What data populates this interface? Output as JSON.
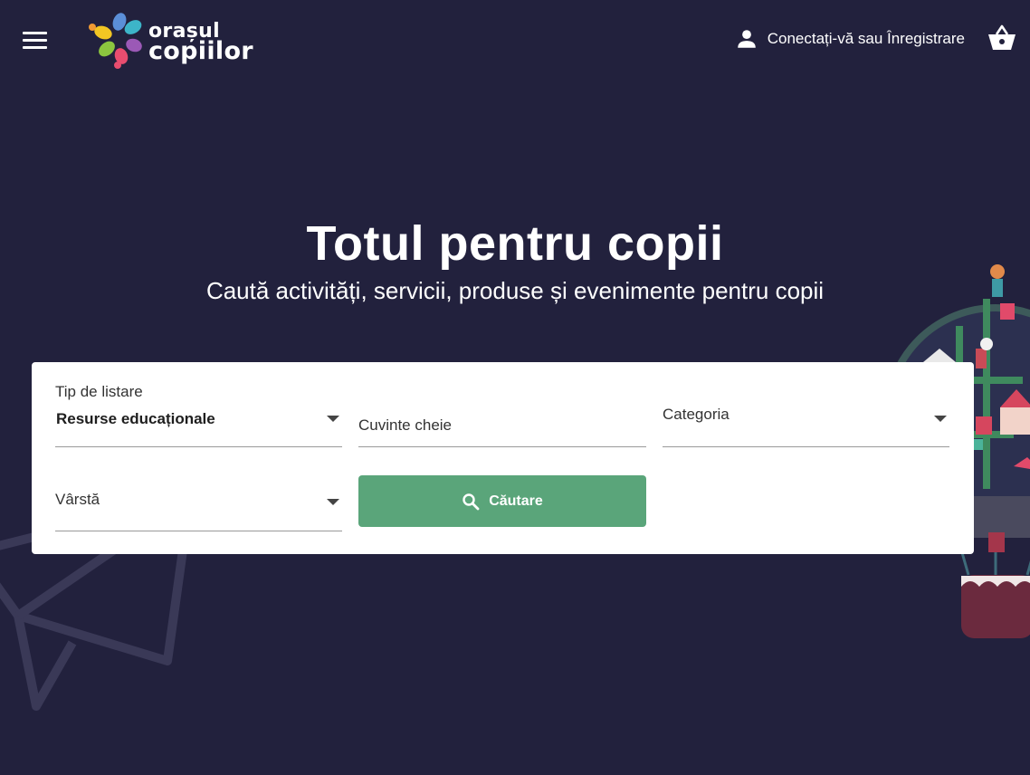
{
  "header": {
    "logo_line1": "orașul",
    "logo_line2": "copiilor",
    "login_label": "Conectați-vă sau Înregistrare"
  },
  "hero": {
    "title": "Totul pentru copii",
    "subtitle": "Caută activități, servicii, produse și evenimente pentru copii"
  },
  "search": {
    "listing_type_label": "Tip de listare",
    "listing_type_value": "Resurse educaționale",
    "keywords_placeholder": "Cuvinte cheie",
    "category_label": "Categoria",
    "age_label": "Vârstă",
    "search_button_label": "Căutare"
  },
  "colors": {
    "background": "#22213d",
    "accent_green": "#5aa57a",
    "card": "#ffffff"
  },
  "icons": {
    "menu": "hamburger-menu-icon",
    "user": "user-icon",
    "cart": "basket-icon",
    "search": "search-icon",
    "dropdown": "caret-down-icon"
  }
}
